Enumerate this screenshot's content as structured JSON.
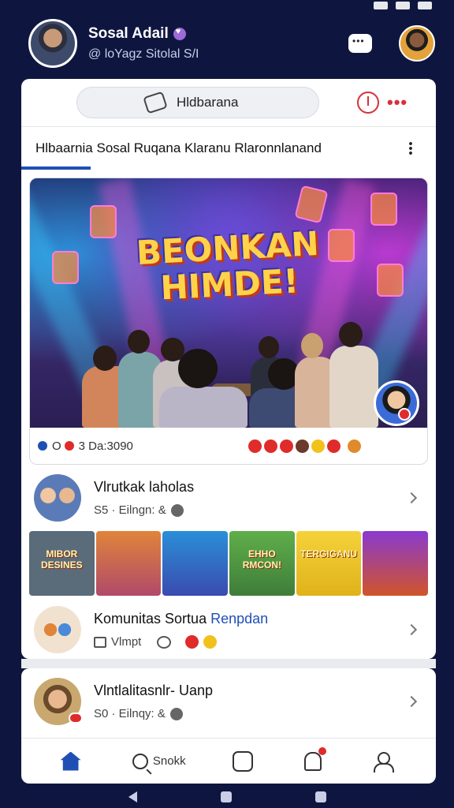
{
  "profile": {
    "name": "Sosal Adail",
    "handle": "@ loYagz Sitolal S/I"
  },
  "search": {
    "label": "Hldbarana"
  },
  "tab": {
    "active_label": "Hlbaarnia Sosal Ruqana Klaranu Rlaronnlanand"
  },
  "banner": {
    "title": "BEONKAN\nHIMDE!",
    "reactions_count": "3 Da:3090",
    "reactions_prefix": "O"
  },
  "items": [
    {
      "title": "Vlrutkak laholas",
      "subtitle": "S5 · Eilngn: &"
    },
    {
      "title": "Komunitas Sortua",
      "title_accent": "Renpdan",
      "subtitle": "Vlmpt"
    },
    {
      "title": "Vlntlalitasnlr- Uanp",
      "subtitle": "S0 · Eilnqy: &"
    }
  ],
  "thumbnails": [
    {
      "label": "MIBOR DESINES",
      "color": "#5a6b7a"
    },
    {
      "label": "",
      "color": "#b04a6a"
    },
    {
      "label": "",
      "color": "#3a4bb0"
    },
    {
      "label": "EHHO RMCON!",
      "color": "#3f7d3a"
    },
    {
      "label": "TERGIGANU",
      "color": "#e0b21a"
    },
    {
      "label": "",
      "color": "#d0542a"
    }
  ],
  "bottom_nav": {
    "home": "",
    "search": "Snokk",
    "games": "",
    "notifications": "",
    "profile": ""
  },
  "colors": {
    "accent": "#1f4fb5",
    "background": "#0e1640",
    "alert": "#d9303a"
  }
}
